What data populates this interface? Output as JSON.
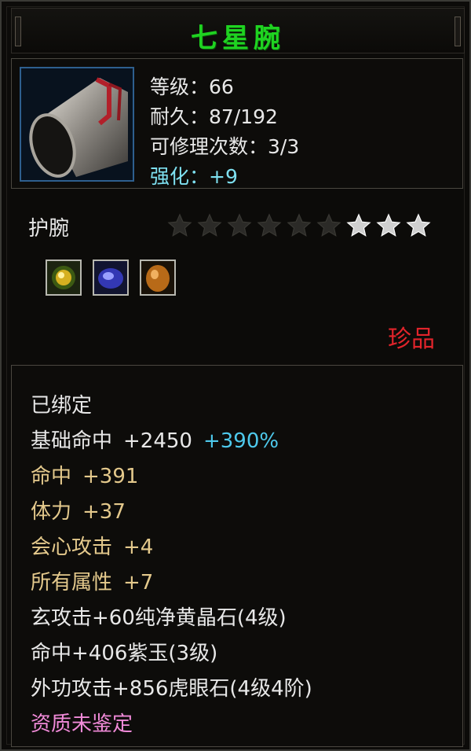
{
  "item": {
    "name": "七星腕",
    "name_color": "#1fd321",
    "icon": "bracer-icon",
    "level_label": "等级：66",
    "durability_label": "耐久：87/192",
    "repair_label": "可修理次数：3/3",
    "enhance_label": "强化：+9",
    "type": "护腕",
    "stars_total": 9,
    "stars_lit": 3,
    "rarity": "珍品",
    "rarity_color": "#e2242b"
  },
  "gems": [
    {
      "name": "yellow-crystal-gem-icon"
    },
    {
      "name": "purple-jade-gem-icon"
    },
    {
      "name": "tiger-eye-gem-icon"
    }
  ],
  "attributes": {
    "bound": "已绑定",
    "base_hit": {
      "label": "基础命中",
      "value": "+2450",
      "bonus": "+390%"
    },
    "stats": [
      {
        "label": "命中",
        "value": "+391"
      },
      {
        "label": "体力",
        "value": "+37"
      },
      {
        "label": "会心攻击",
        "value": "+4"
      },
      {
        "label": "所有属性",
        "value": "+7"
      }
    ],
    "gem_lines": [
      "玄攻击+60纯净黄晶石(4级)",
      "命中+406紫玉(3级)",
      "外功攻击+856虎眼石(4级4阶)"
    ],
    "quality": "资质未鉴定"
  }
}
